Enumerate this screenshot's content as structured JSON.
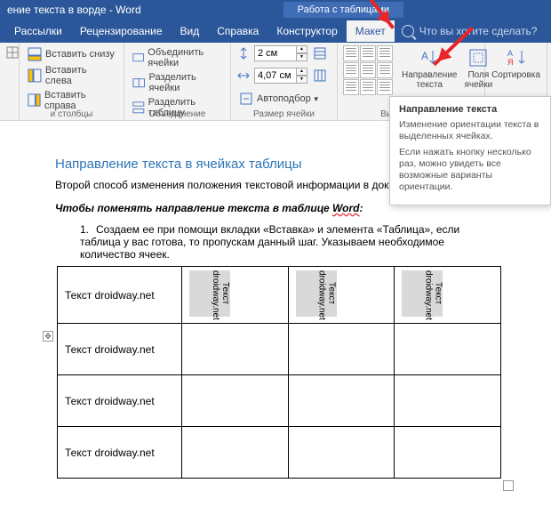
{
  "titlebar": {
    "doc_title": "ение текста в ворде  -  Word",
    "context": "Работа с таблицами"
  },
  "menu": {
    "mail": "Рассылки",
    "review": "Рецензирование",
    "view": "Вид",
    "help": "Справка",
    "design": "Конструктор",
    "layout": "Макет",
    "tell_me": "Что вы хотите сделать?"
  },
  "ribbon": {
    "rows_cols": {
      "insert_below": "Вставить снизу",
      "insert_left": "Вставить слева",
      "insert_right": "Вставить справа",
      "label": "и столбцы"
    },
    "merge": {
      "merge": "Объединить ячейки",
      "split": "Разделить ячейки",
      "split_table": "Разделить таблицу",
      "label": "Объединение"
    },
    "size": {
      "h": "2 см",
      "w": "4,07 см",
      "autofit": "Автоподбор",
      "label": "Размер ячейки"
    },
    "align": {
      "text_dir": "Направление текста",
      "margins": "Поля ячейки",
      "label": "Выравнивание"
    },
    "sort": {
      "sort": "Сортировка"
    }
  },
  "tooltip": {
    "title": "Направление текста",
    "line1": "Изменение ориентации текста в выделенных ячейках.",
    "line2": "Если нажать кнопку несколько раз, можно увидеть все возможные варианты ориентации."
  },
  "doc": {
    "heading": "Направление текста в ячейках таблицы",
    "p1": "Второй способ изменения положения текстовой информации в докуме                                           таблицу.",
    "p2_pre": "Чтобы поменять направление текста в ",
    "p2_mid": "таблице ",
    "p2_word": "Word",
    "li1": "Создаем ее при помощи вкладки «Вставка» и элемента «Таблица», если таблица у вас готова, то пропускам данный шаг. Указываем необходимое количество ячеек.",
    "cell_h": "Текст droidway.net",
    "cell_r": "Текст droidway.net"
  }
}
